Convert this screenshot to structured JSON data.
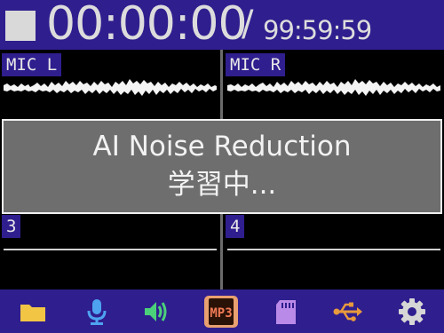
{
  "recorder": {
    "elapsed": "00:00:00",
    "separator": "/",
    "remaining": "99:59:59"
  },
  "tracks": [
    {
      "label": "MIC L"
    },
    {
      "label": "MIC R"
    },
    {
      "label": "3"
    },
    {
      "label": "4"
    }
  ],
  "dialog": {
    "line1": "AI Noise Reduction",
    "line2": "学習中..."
  },
  "bottom_icons": [
    "folder-icon",
    "microphone-icon",
    "speaker-icon",
    "mp3-icon",
    "sd-card-icon",
    "usb-icon",
    "gear-icon"
  ],
  "colors": {
    "bar": "#2f1e8e",
    "folder": "#f2c544",
    "microphone": "#4ea3f0",
    "speaker": "#4bd07a",
    "mp3": "#f07a55",
    "sd_card": "#b98ae8",
    "usb": "#e89a3c",
    "gear": "#d6d6d6"
  }
}
